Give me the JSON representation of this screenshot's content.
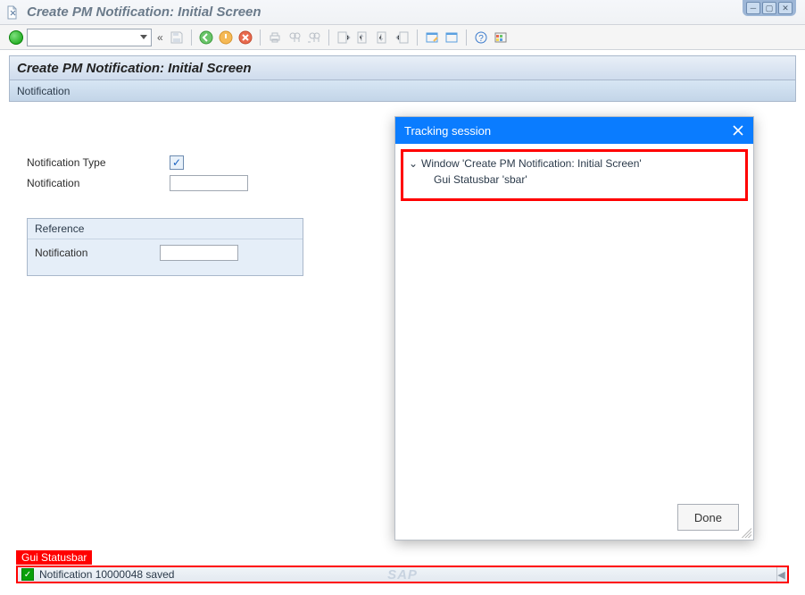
{
  "window": {
    "title": "Create PM Notification: Initial Screen"
  },
  "header": {
    "title": "Create PM Notification: Initial Screen",
    "subtitle": "Notification"
  },
  "form": {
    "notification_type_label": "Notification Type",
    "notification_type_checked": "✓",
    "notification_label": "Notification",
    "notification_value": ""
  },
  "reference_group": {
    "title": "Reference",
    "notification_label": "Notification",
    "notification_value": ""
  },
  "statusbar": {
    "label": "Gui Statusbar",
    "message": "Notification 10000048 saved",
    "logo": "SAP"
  },
  "dialog": {
    "title": "Tracking session",
    "tree": {
      "root": "Window 'Create PM Notification: Initial Screen'",
      "child": "Gui Statusbar 'sbar'"
    },
    "done_label": "Done"
  },
  "toolbar": {
    "chev": "«"
  }
}
